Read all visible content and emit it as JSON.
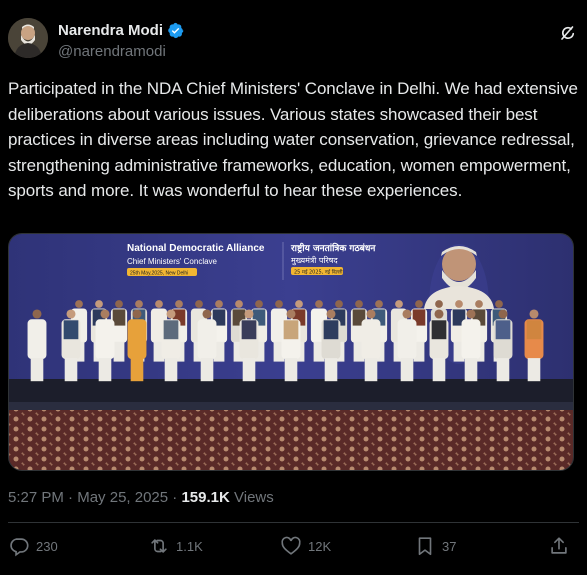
{
  "author": {
    "display_name": "Narendra Modi",
    "handle": "@narendramodi",
    "verified": true
  },
  "icons": {
    "verified": "verified-badge-icon",
    "grok": "grok-icon",
    "reply": "reply-icon",
    "repost": "repost-icon",
    "like": "like-icon",
    "bookmark": "bookmark-icon",
    "share": "share-icon"
  },
  "tweet": {
    "text": "Participated in the NDA Chief Ministers' Conclave in Delhi. We had extensive deliberations about various issues. Various states showcased their best practices in diverse areas including water conservation, grievance redressal, strengthening administrative frameworks, education, women empowerment, sports and more. It was wonderful to hear these experiences."
  },
  "media": {
    "banner_title": "National Democratic Alliance",
    "banner_subtitle": "Chief Ministers' Conclave",
    "banner_date": "25th May,2025, New Delhi",
    "banner_hindi_title": "राष्ट्रीय जनतांत्रिक गठबंधन",
    "banner_hindi_subtitle": "मुख्यमंत्री परिषद",
    "banner_hindi_date": "25 मई 2025, नई दिल्ली"
  },
  "meta": {
    "time": "5:27 PM",
    "separator": " · ",
    "date": "May 25, 2025",
    "views_count": "159.1K",
    "views_label": " Views"
  },
  "actions": {
    "reply_count": "230",
    "repost_count": "1.1K",
    "like_count": "12K",
    "bookmark_count": "37"
  },
  "colors": {
    "background": "#000000",
    "text_primary": "#e7e9ea",
    "text_secondary": "#71767b",
    "verified": "#1d9bf0",
    "banner": "#3a3d8a"
  }
}
